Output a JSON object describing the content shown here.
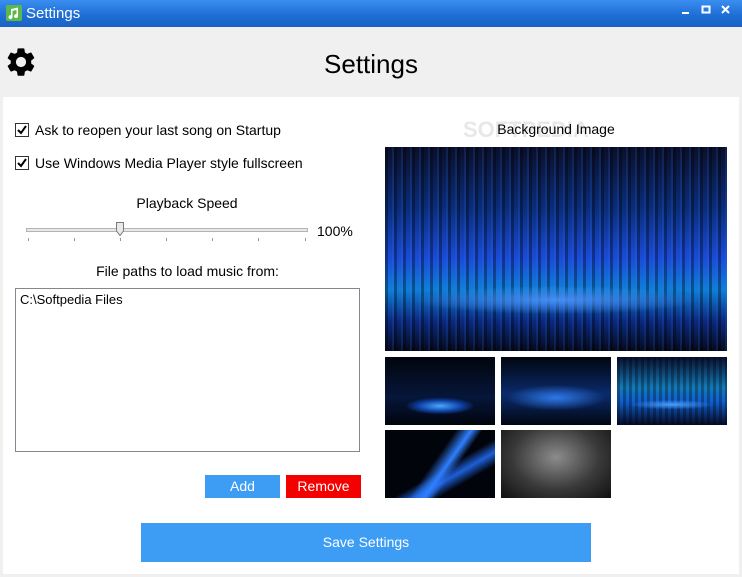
{
  "window": {
    "title": "Settings"
  },
  "header": {
    "title": "Settings"
  },
  "options": {
    "reopen_label": "Ask to reopen your last song on Startup",
    "fullscreen_label": "Use Windows Media Player style fullscreen"
  },
  "playback": {
    "label": "Playback Speed",
    "value_text": "100%",
    "level": 0.33
  },
  "paths": {
    "label": "File paths to load music from:",
    "items": [
      "C:\\Softpedia Files"
    ]
  },
  "buttons": {
    "add": "Add",
    "remove": "Remove",
    "save": "Save Settings"
  },
  "background": {
    "label": "Background Image",
    "watermark": "SOFTPEDIA"
  },
  "colors": {
    "accent": "#3d9df5",
    "danger": "#f40000",
    "titlebar": "#1f6fd6"
  }
}
